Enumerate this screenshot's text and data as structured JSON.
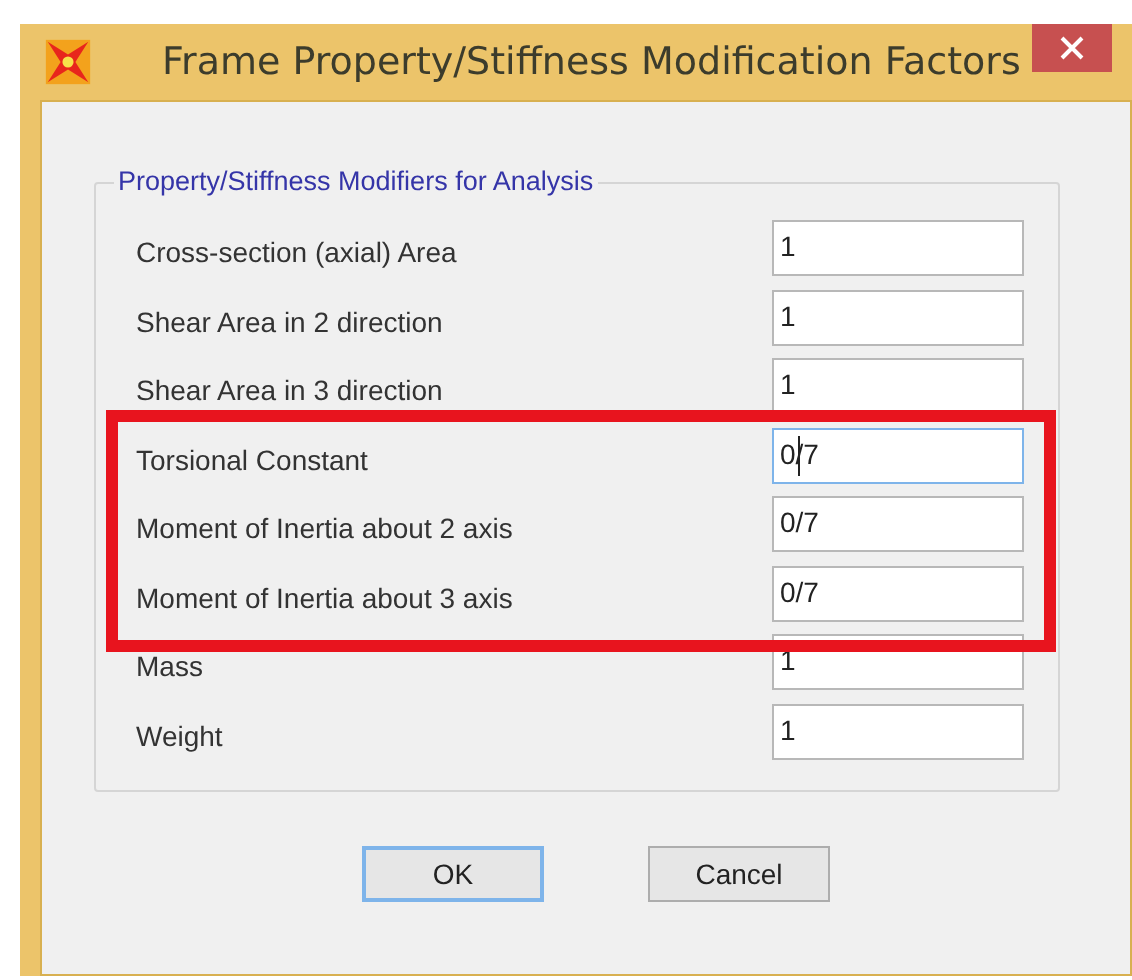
{
  "window": {
    "title": "Frame Property/Stiffness Modification Factors"
  },
  "group": {
    "title": "Property/Stiffness Modifiers for Analysis"
  },
  "fields": [
    {
      "label": "Cross-section (axial) Area",
      "value": "1",
      "focused": false
    },
    {
      "label": "Shear Area in 2 direction",
      "value": "1",
      "focused": false
    },
    {
      "label": "Shear Area in 3 direction",
      "value": "1",
      "focused": false
    },
    {
      "label": "Torsional Constant",
      "value": "0/7",
      "focused": true
    },
    {
      "label": "Moment of Inertia about 2 axis",
      "value": "0/7",
      "focused": false
    },
    {
      "label": "Moment of Inertia about 3 axis",
      "value": "0/7",
      "focused": false
    },
    {
      "label": "Mass",
      "value": "1",
      "focused": false
    },
    {
      "label": "Weight",
      "value": "1",
      "focused": false
    }
  ],
  "buttons": [
    {
      "label": "OK",
      "default": true
    },
    {
      "label": "Cancel",
      "default": false
    }
  ]
}
